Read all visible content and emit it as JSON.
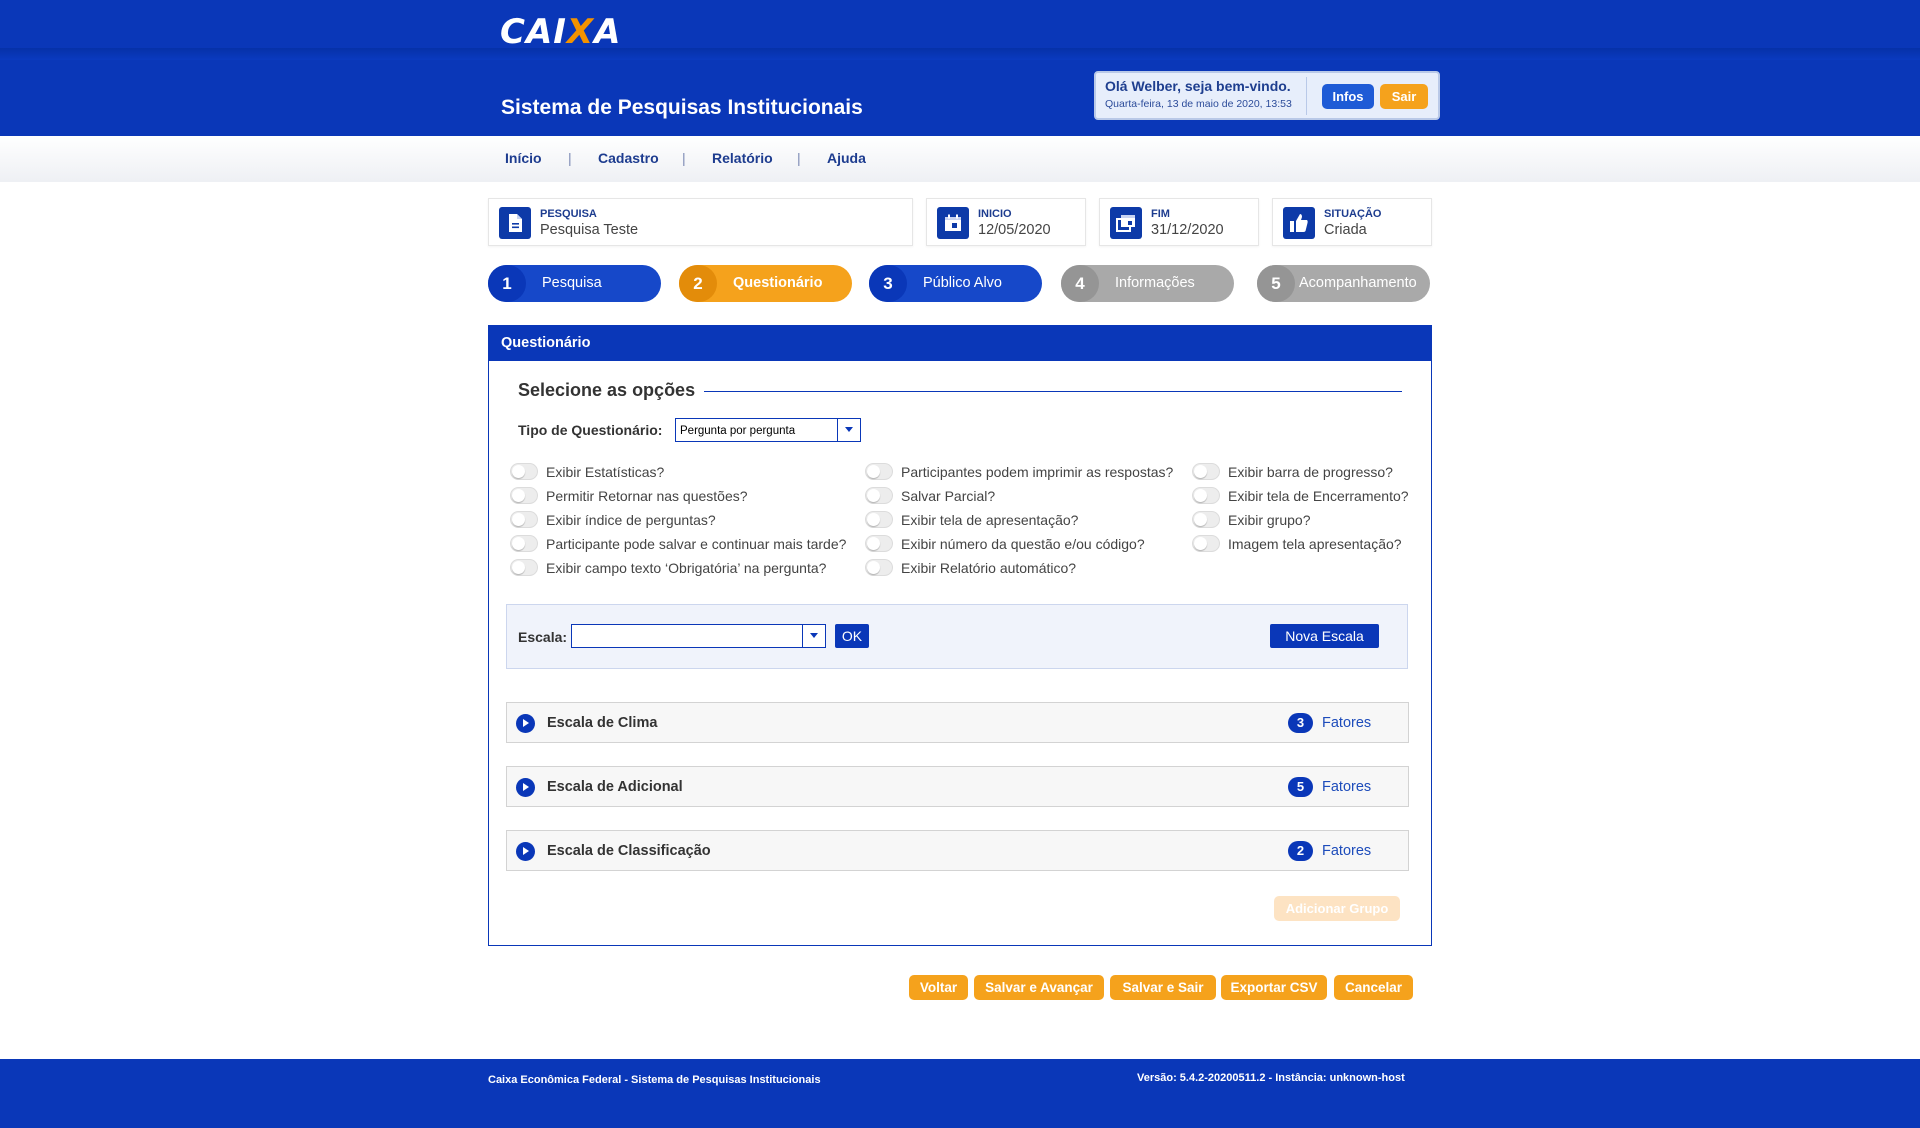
{
  "header": {
    "logo_prefix": "CAI",
    "logo_x": "X",
    "logo_suffix": "A",
    "app_title": "Sistema de Pesquisas Institucionais",
    "welcome_name": "Olá Welber, seja bem-vindo.",
    "welcome_date": "Quarta-feira, 13 de maio de 2020, 13:53",
    "infos_label": "Infos",
    "sair_label": "Sair"
  },
  "nav": {
    "items": [
      "Início",
      "Cadastro",
      "Relatório",
      "Ajuda"
    ],
    "separator": "|"
  },
  "info": {
    "pesquisa": {
      "label": "PESQUISA",
      "value": "Pesquisa Teste"
    },
    "inicio": {
      "label": "INICIO",
      "value": "12/05/2020"
    },
    "fim": {
      "label": "FIM",
      "value": "31/12/2020"
    },
    "situacao": {
      "label": "SITUAÇÃO",
      "value": "Criada"
    }
  },
  "steps": [
    {
      "num": "1",
      "label": "Pesquisa",
      "state": "done"
    },
    {
      "num": "2",
      "label": "Questionário",
      "state": "active"
    },
    {
      "num": "3",
      "label": "Público Alvo",
      "state": "done"
    },
    {
      "num": "4",
      "label": "Informações",
      "state": "disabled"
    },
    {
      "num": "5",
      "label": "Acompanhamento",
      "state": "disabled"
    }
  ],
  "panel": {
    "title": "Questionário",
    "section_title": "Selecione as opções",
    "tipo_label": "Tipo de Questionário:",
    "tipo_value": "Pergunta por pergunta",
    "options": {
      "col1": [
        "Exibir Estatísticas?",
        "Permitir Retornar nas questões?",
        "Exibir índice de perguntas?",
        "Participante pode salvar e continuar mais tarde?",
        "Exibir campo texto ‘Obrigatória’ na pergunta?"
      ],
      "col2": [
        "Participantes podem imprimir as respostas?",
        "Salvar Parcial?",
        "Exibir tela de apresentação?",
        "Exibir número da questão e/ou código?",
        "Exibir  Relatório automático?"
      ],
      "col3": [
        "Exibir barra de progresso?",
        "Exibir tela de Encerramento?",
        "Exibir grupo?",
        "Imagem tela apresentação?"
      ]
    },
    "escala_label": "Escala:",
    "escala_value": "",
    "ok_label": "OK",
    "nova_escala_label": "Nova Escala",
    "scales": [
      {
        "title": "Escala de Clima",
        "count": "3",
        "fatores": "Fatores"
      },
      {
        "title": "Escala de Adicional",
        "count": "5",
        "fatores": "Fatores"
      },
      {
        "title": "Escala de Classificação",
        "count": "2",
        "fatores": "Fatores"
      }
    ],
    "add_group_label": "Adicionar Grupo"
  },
  "actions": {
    "voltar": "Voltar",
    "salvar_avancar": "Salvar e Avançar",
    "salvar_sair": "Salvar e Sair",
    "exportar_csv": "Exportar CSV",
    "cancelar": "Cancelar"
  },
  "footer": {
    "left": "Caixa Econômica Federal - Sistema de Pesquisas Institucionais",
    "right": "Versão: 5.4.2-20200511.2 - Instância: unknown-host"
  },
  "colors": {
    "primary": "#0a37b8",
    "accent": "#f5a21c",
    "step_disabled": "#a6a6a6"
  }
}
